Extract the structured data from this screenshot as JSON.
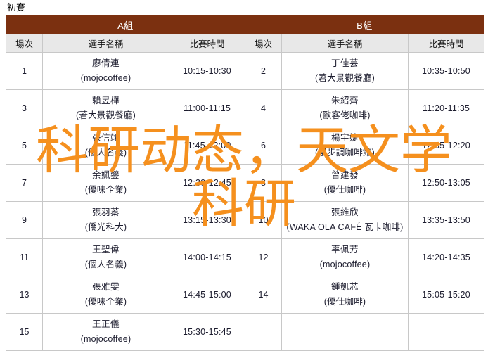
{
  "page": {
    "title": "初賽"
  },
  "table": {
    "groups": [
      {
        "label": "A組"
      },
      {
        "label": "B組"
      }
    ],
    "columns": {
      "match_no": "場次",
      "player_name": "選手名稱",
      "match_time": "比賽時間"
    },
    "rows": [
      {
        "a": {
          "no": "1",
          "name": "廖倩連",
          "org": "(mojocoffee)",
          "time": "10:15-10:30"
        },
        "b": {
          "no": "2",
          "name": "丁佳芸",
          "org": "(莙大景觀餐廳)",
          "time": "10:35-10:50"
        }
      },
      {
        "a": {
          "no": "3",
          "name": "賴昱樺",
          "org": "(莙大景觀餐廳)",
          "time": "11:00-11:15"
        },
        "b": {
          "no": "4",
          "name": "朱紹齊",
          "org": "(歐客佬咖啡)",
          "time": "11:20-11:35"
        }
      },
      {
        "a": {
          "no": "5",
          "name": "張信翊",
          "org": "(個人名義)",
          "time": "11:45-12:00"
        },
        "b": {
          "no": "6",
          "name": "楊宇婕",
          "org": "(慢步調咖啡館)",
          "time": "12:05-12:20"
        }
      },
      {
        "a": {
          "no": "7",
          "name": "余姵鎣",
          "org": "(優味企業)",
          "time": "12:30-12:45"
        },
        "b": {
          "no": "8",
          "name": "曾建發",
          "org": "(優仕咖啡)",
          "time": "12:50-13:05"
        }
      },
      {
        "a": {
          "no": "9",
          "name": "張羽蓁",
          "org": "(僑光科大)",
          "time": "13:15-13:30"
        },
        "b": {
          "no": "10",
          "name": "張維欣",
          "org": "(WAKA OLA CAFÉ 瓦卡咖啡)",
          "time": "13:35-13:50"
        }
      },
      {
        "a": {
          "no": "11",
          "name": "王聖偉",
          "org": "(個人名義)",
          "time": "14:00-14:15"
        },
        "b": {
          "no": "12",
          "name": "辜佩芳",
          "org": "(mojocoffee)",
          "time": "14:20-14:35"
        }
      },
      {
        "a": {
          "no": "13",
          "name": "張雅雯",
          "org": "(優味企業)",
          "time": "14:45-15:00"
        },
        "b": {
          "no": "14",
          "name": "鍾凱芯",
          "org": "(優仕咖啡)",
          "time": "15:05-15:20"
        }
      },
      {
        "a": {
          "no": "15",
          "name": "王正儀",
          "org": "(mojocoffee)",
          "time": "15:30-15:45"
        },
        "b": {
          "no": "",
          "name": "",
          "org": "",
          "time": ""
        }
      }
    ]
  },
  "watermark": {
    "line1": "科研动态，天文学",
    "line2": "科研",
    "color": "#F5901E"
  },
  "colors": {
    "group_header_bg": "#7B3010",
    "column_header_bg": "#e8e8e8",
    "border": "#c8c8c8",
    "text": "#1c1c2e"
  }
}
